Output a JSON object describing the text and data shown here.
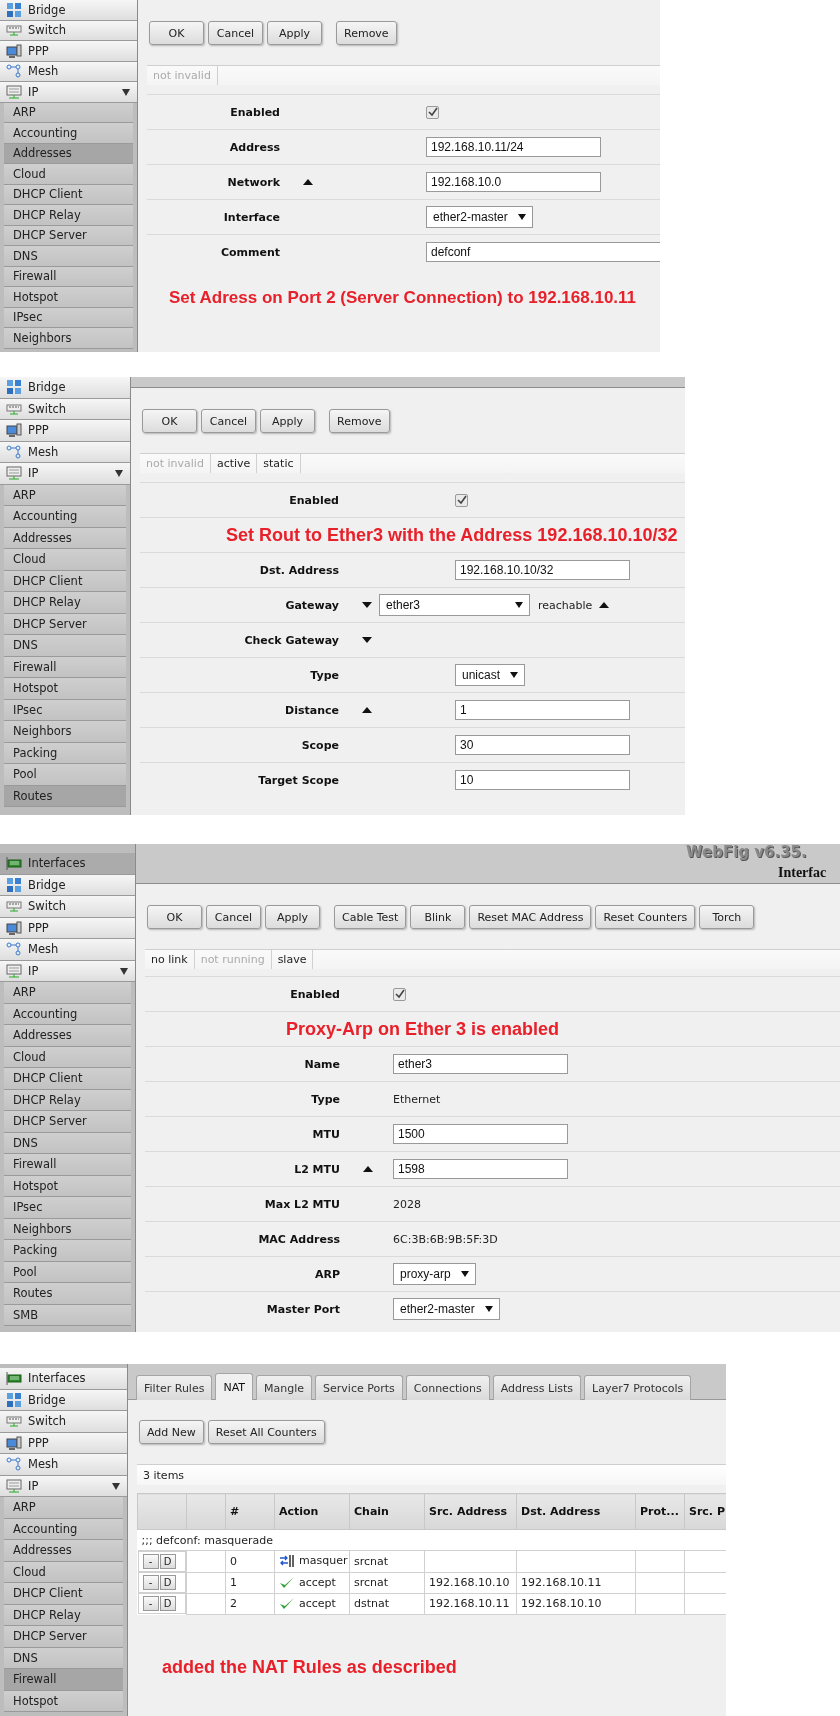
{
  "panels": [
    {
      "sidebar": {
        "items": [
          {
            "label": "Bridge",
            "kind": "bridge",
            "selected": false
          },
          {
            "label": "Switch",
            "kind": "switch",
            "selected": false
          },
          {
            "label": "PPP",
            "kind": "ppp",
            "selected": false
          },
          {
            "label": "Mesh",
            "kind": "mesh",
            "selected": false
          },
          {
            "label": "IP",
            "kind": "ip",
            "selected": false,
            "expanded": true,
            "children": [
              {
                "label": "ARP",
                "selected": false
              },
              {
                "label": "Accounting",
                "selected": false
              },
              {
                "label": "Addresses",
                "selected": true
              },
              {
                "label": "Cloud",
                "selected": false
              },
              {
                "label": "DHCP Client",
                "selected": false
              },
              {
                "label": "DHCP Relay",
                "selected": false
              },
              {
                "label": "DHCP Server",
                "selected": false
              },
              {
                "label": "DNS",
                "selected": false
              },
              {
                "label": "Firewall",
                "selected": false
              },
              {
                "label": "Hotspot",
                "selected": false
              },
              {
                "label": "IPsec",
                "selected": false
              },
              {
                "label": "Neighbors",
                "selected": false
              }
            ]
          }
        ]
      },
      "main": [
        {
          "kind": "buttons",
          "groups": [
            [
              "OK",
              "Cancel",
              "Apply"
            ],
            [
              "Remove"
            ]
          ]
        },
        {
          "kind": "flags",
          "items": [
            {
              "text": "not invalid",
              "dim": true
            }
          ]
        },
        {
          "kind": "form",
          "rows": [
            {
              "kind": "checkbox",
              "label": "Enabled",
              "checked": true
            },
            {
              "kind": "text",
              "label": "Address",
              "value": "192.168.10.11/24"
            },
            {
              "kind": "text",
              "label": "Network",
              "value": "192.168.10.0",
              "expanded": true
            },
            {
              "kind": "select",
              "label": "Interface",
              "value": "ether2-master"
            },
            {
              "kind": "comment",
              "label": "Comment",
              "value": "defconf"
            }
          ]
        },
        {
          "kind": "note",
          "text": "Set Adress on Port 2 (Server Connection) to 192.168.10.11"
        }
      ]
    },
    {
      "sidebar": {
        "items": [
          {
            "label": "Bridge",
            "kind": "bridge",
            "selected": false
          },
          {
            "label": "Switch",
            "kind": "switch",
            "selected": false
          },
          {
            "label": "PPP",
            "kind": "ppp",
            "selected": false
          },
          {
            "label": "Mesh",
            "kind": "mesh",
            "selected": false
          },
          {
            "label": "IP",
            "kind": "ip",
            "selected": false,
            "expanded": true,
            "children": [
              {
                "label": "ARP",
                "selected": false
              },
              {
                "label": "Accounting",
                "selected": false
              },
              {
                "label": "Addresses",
                "selected": false
              },
              {
                "label": "Cloud",
                "selected": false
              },
              {
                "label": "DHCP Client",
                "selected": false
              },
              {
                "label": "DHCP Relay",
                "selected": false
              },
              {
                "label": "DHCP Server",
                "selected": false
              },
              {
                "label": "DNS",
                "selected": false
              },
              {
                "label": "Firewall",
                "selected": false
              },
              {
                "label": "Hotspot",
                "selected": false
              },
              {
                "label": "IPsec",
                "selected": false
              },
              {
                "label": "Neighbors",
                "selected": false
              },
              {
                "label": "Packing",
                "selected": false
              },
              {
                "label": "Pool",
                "selected": false
              },
              {
                "label": "Routes",
                "selected": true
              }
            ]
          }
        ]
      },
      "main": [
        {
          "kind": "header"
        },
        {
          "kind": "buttons",
          "groups": [
            [
              "OK",
              "Cancel",
              "Apply"
            ],
            [
              "Remove"
            ]
          ]
        },
        {
          "kind": "flags",
          "items": [
            {
              "text": "not invalid",
              "dim": true
            },
            {
              "text": "active",
              "dim": false
            },
            {
              "text": "static",
              "dim": false
            }
          ]
        },
        {
          "kind": "form",
          "rows": [
            {
              "kind": "checkbox",
              "label": "Enabled",
              "checked": true
            },
            {
              "kind": "note",
              "text": "Set Rout to Ether3 with the Address 192.168.10.10/32"
            },
            {
              "kind": "text",
              "label": "Dst. Address",
              "value": "192.168.10.10/32"
            },
            {
              "kind": "select",
              "label": "Gateway",
              "value": "ether3",
              "expanded": false,
              "status": "reachable",
              "status_expanded": true
            },
            {
              "kind": "label",
              "label": "Check Gateway",
              "expanded": false
            },
            {
              "kind": "select",
              "label": "Type",
              "value": "unicast"
            },
            {
              "kind": "text",
              "label": "Distance",
              "value": "1",
              "expanded": true
            },
            {
              "kind": "text",
              "label": "Scope",
              "value": "30"
            },
            {
              "kind": "text",
              "label": "Target Scope",
              "value": "10"
            }
          ]
        }
      ]
    },
    {
      "sidebar": {
        "items": [
          {
            "label": "Interfaces",
            "kind": "interfaces",
            "selected": true
          },
          {
            "label": "Bridge",
            "kind": "bridge",
            "selected": false
          },
          {
            "label": "Switch",
            "kind": "switch",
            "selected": false
          },
          {
            "label": "PPP",
            "kind": "ppp",
            "selected": false
          },
          {
            "label": "Mesh",
            "kind": "mesh",
            "selected": false
          },
          {
            "label": "IP",
            "kind": "ip",
            "selected": false,
            "expanded": true,
            "children": [
              {
                "label": "ARP",
                "selected": false
              },
              {
                "label": "Accounting",
                "selected": false
              },
              {
                "label": "Addresses",
                "selected": false
              },
              {
                "label": "Cloud",
                "selected": false
              },
              {
                "label": "DHCP Client",
                "selected": false
              },
              {
                "label": "DHCP Relay",
                "selected": false
              },
              {
                "label": "DHCP Server",
                "selected": false
              },
              {
                "label": "DNS",
                "selected": false
              },
              {
                "label": "Firewall",
                "selected": false
              },
              {
                "label": "Hotspot",
                "selected": false
              },
              {
                "label": "IPsec",
                "selected": false
              },
              {
                "label": "Neighbors",
                "selected": false
              },
              {
                "label": "Packing",
                "selected": false
              },
              {
                "label": "Pool",
                "selected": false
              },
              {
                "label": "Routes",
                "selected": false
              },
              {
                "label": "SMB",
                "selected": false
              }
            ]
          }
        ]
      },
      "main": [
        {
          "kind": "header",
          "title": "WebFig v6.35.",
          "heading": "Interfac"
        },
        {
          "kind": "buttons",
          "groups": [
            [
              "OK",
              "Cancel",
              "Apply"
            ],
            [
              "Cable Test",
              "Blink",
              "Reset MAC Address",
              "Reset Counters",
              "Torch"
            ]
          ]
        },
        {
          "kind": "flags",
          "items": [
            {
              "text": "no link",
              "dim": false
            },
            {
              "text": "not running",
              "dim": true
            },
            {
              "text": "slave",
              "dim": false
            }
          ]
        },
        {
          "kind": "form",
          "rows": [
            {
              "kind": "checkbox",
              "label": "Enabled",
              "checked": true
            },
            {
              "kind": "note",
              "text": "Proxy-Arp on Ether 3 is enabled"
            },
            {
              "kind": "text",
              "label": "Name",
              "value": "ether3"
            },
            {
              "kind": "readonly",
              "label": "Type",
              "value": "Ethernet"
            },
            {
              "kind": "text",
              "label": "MTU",
              "value": "1500"
            },
            {
              "kind": "text",
              "label": "L2 MTU",
              "value": "1598",
              "expanded": true
            },
            {
              "kind": "readonly",
              "label": "Max L2 MTU",
              "value": "2028"
            },
            {
              "kind": "readonly",
              "label": "MAC Address",
              "value": "6C:3B:6B:9B:5F:3D"
            },
            {
              "kind": "select",
              "label": "ARP",
              "value": "proxy-arp"
            },
            {
              "kind": "select",
              "label": "Master Port",
              "value": "ether2-master"
            }
          ]
        }
      ]
    },
    {
      "sidebar": {
        "items": [
          {
            "label": "Interfaces",
            "kind": "interfaces",
            "selected": false
          },
          {
            "label": "Bridge",
            "kind": "bridge",
            "selected": false
          },
          {
            "label": "Switch",
            "kind": "switch",
            "selected": false
          },
          {
            "label": "PPP",
            "kind": "ppp",
            "selected": false
          },
          {
            "label": "Mesh",
            "kind": "mesh",
            "selected": false
          },
          {
            "label": "IP",
            "kind": "ip",
            "selected": false,
            "expanded": true,
            "children": [
              {
                "label": "ARP",
                "selected": false
              },
              {
                "label": "Accounting",
                "selected": false
              },
              {
                "label": "Addresses",
                "selected": false
              },
              {
                "label": "Cloud",
                "selected": false
              },
              {
                "label": "DHCP Client",
                "selected": false
              },
              {
                "label": "DHCP Relay",
                "selected": false
              },
              {
                "label": "DHCP Server",
                "selected": false
              },
              {
                "label": "DNS",
                "selected": false
              },
              {
                "label": "Firewall",
                "selected": true
              },
              {
                "label": "Hotspot",
                "selected": false
              }
            ]
          }
        ]
      },
      "main": [
        {
          "kind": "tabs",
          "items": [
            {
              "label": "Filter Rules",
              "selected": false
            },
            {
              "label": "NAT",
              "selected": true
            },
            {
              "label": "Mangle",
              "selected": false
            },
            {
              "label": "Service Ports",
              "selected": false
            },
            {
              "label": "Connections",
              "selected": false
            },
            {
              "label": "Address Lists",
              "selected": false
            },
            {
              "label": "Layer7 Protocols",
              "selected": false
            }
          ]
        },
        {
          "kind": "buttons",
          "groups": [
            [
              "Add New",
              "Reset All Counters"
            ]
          ]
        },
        {
          "kind": "count",
          "text": "3 items"
        },
        {
          "kind": "table",
          "columns": [
            "#",
            "Action",
            "Chain",
            "Src. Address",
            "Dst. Address",
            "Prot...",
            "Src. P"
          ],
          "rows": [
            {
              "comment": ";;; defconf: masquerade",
              "buttons": [
                "-",
                "D"
              ],
              "number": "0",
              "action": {
                "kind": "masquerade",
                "text": "masquer"
              },
              "chain": "srcnat"
            },
            {
              "buttons": [
                "-",
                "D"
              ],
              "number": "1",
              "action": {
                "kind": "accept",
                "text": "accept"
              },
              "chain": "srcnat",
              "src": "192.168.10.10",
              "dst": "192.168.10.11"
            },
            {
              "buttons": [
                "-",
                "D"
              ],
              "number": "2",
              "action": {
                "kind": "accept",
                "text": "accept"
              },
              "chain": "dstnat",
              "src": "192.168.10.11",
              "dst": "192.168.10.10"
            }
          ]
        },
        {
          "kind": "note",
          "text": "added the NAT Rules as described"
        }
      ]
    }
  ]
}
